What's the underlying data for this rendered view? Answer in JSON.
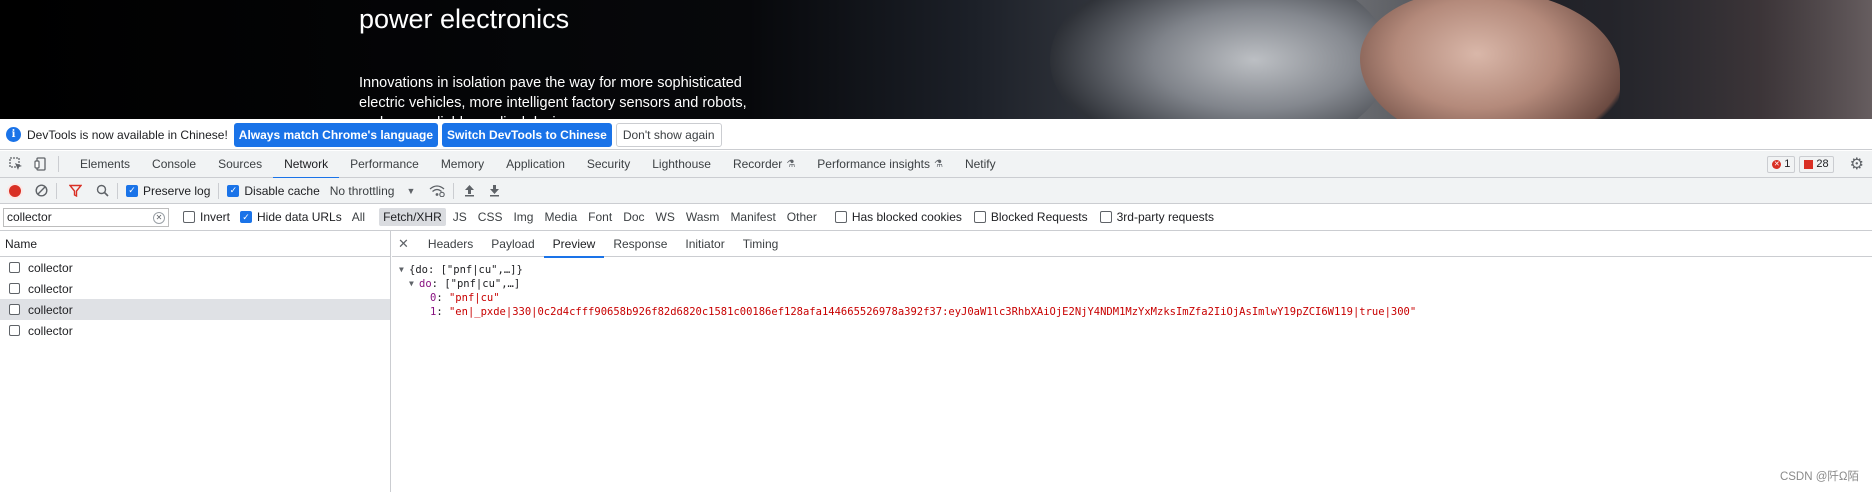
{
  "hero": {
    "title": "power electronics",
    "paragraph": "Innovations in isolation pave the way for more sophisticated electric vehicles, more intelligent factory sensors and robots, and more reliable medical devices."
  },
  "infobar": {
    "message": "DevTools is now available in Chinese!",
    "btn_match": "Always match Chrome's language",
    "btn_switch": "Switch DevTools to Chinese",
    "btn_dismiss": "Don't show again"
  },
  "tabs": [
    "Elements",
    "Console",
    "Sources",
    "Network",
    "Performance",
    "Memory",
    "Application",
    "Security",
    "Lighthouse",
    "Recorder",
    "Performance insights",
    "Netify"
  ],
  "active_tab": "Network",
  "counters": {
    "errors": "1",
    "issues": "28"
  },
  "toolbar": {
    "preserve_log": "Preserve log",
    "disable_cache": "Disable cache",
    "throttling": "No throttling"
  },
  "filter": {
    "value": "collector",
    "invert": "Invert",
    "hide_data_urls": "Hide data URLs",
    "types": [
      "All",
      "Fetch/XHR",
      "JS",
      "CSS",
      "Img",
      "Media",
      "Font",
      "Doc",
      "WS",
      "Wasm",
      "Manifest",
      "Other"
    ],
    "active_type": "Fetch/XHR",
    "has_blocked_cookies": "Has blocked cookies",
    "blocked_requests": "Blocked Requests",
    "third_party": "3rd-party requests"
  },
  "requests": {
    "header": "Name",
    "rows": [
      "collector",
      "collector",
      "collector",
      "collector"
    ],
    "selected_index": 2
  },
  "detail": {
    "tabs": [
      "Headers",
      "Payload",
      "Preview",
      "Response",
      "Initiator",
      "Timing"
    ],
    "active_tab": "Preview",
    "line1": "{do: [\"pnf|cu\",…]}",
    "line2_key": "do",
    "line2_val": "[\"pnf|cu\",…]",
    "item0_key": "0",
    "item0_val": "\"pnf|cu\"",
    "item1_key": "1",
    "item1_val": "\"en|_pxde|330|0c2d4cfff90658b926f82d6820c1581c00186ef128afa144665526978a392f37:eyJ0aW1lc3RhbXAiOjE2NjY4NDM1MzYxMzksImZfa2IiOjAsImlwY19pZCI6W119|true|300\""
  },
  "watermark": "CSDN @阡Ω陌"
}
